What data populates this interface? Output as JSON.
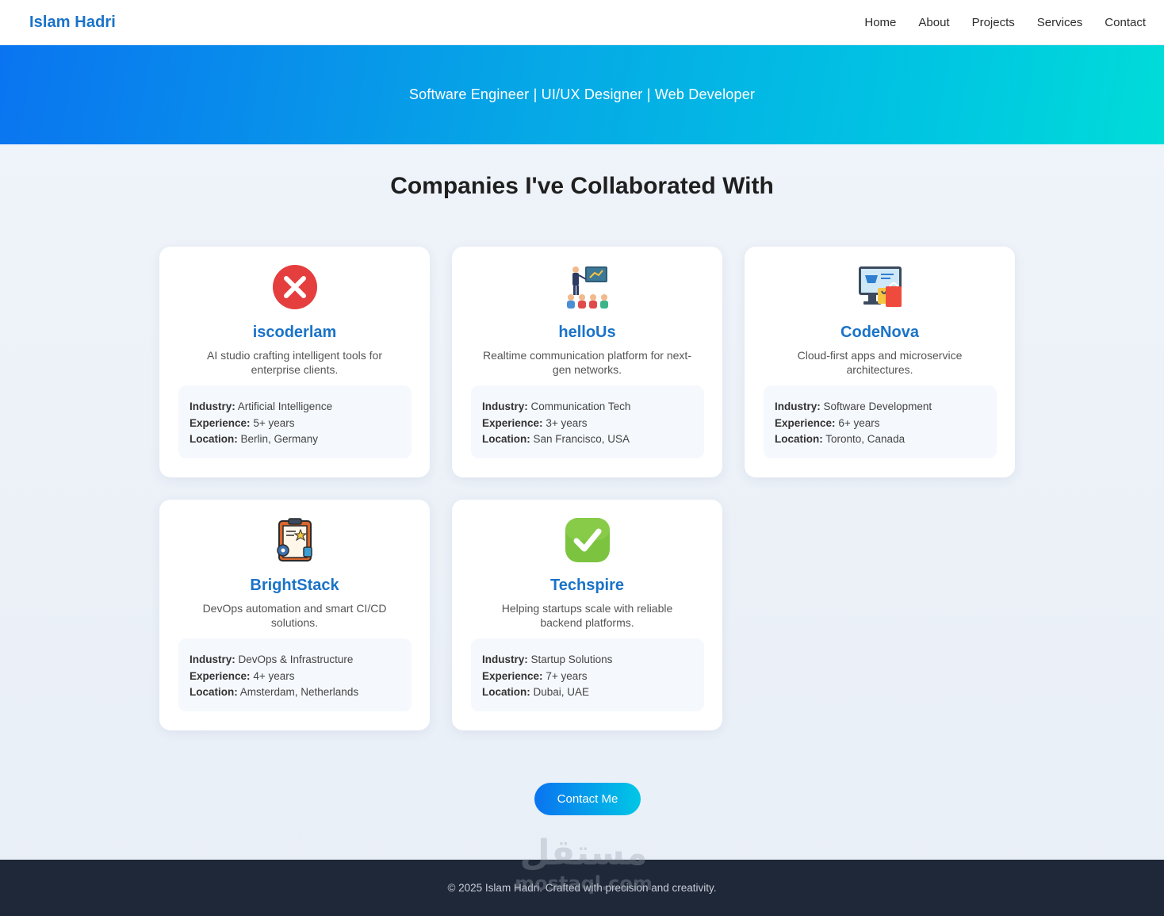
{
  "header": {
    "brand": "Islam Hadri",
    "nav": [
      "Home",
      "About",
      "Projects",
      "Services",
      "Contact"
    ]
  },
  "hero": {
    "tagline": "Software Engineer | UI/UX Designer | Web Developer"
  },
  "section": {
    "title": "Companies I've Collaborated With"
  },
  "labels": {
    "industry": "Industry:",
    "experience": "Experience:",
    "location": "Location:"
  },
  "companies": [
    {
      "name": "iscoderlam",
      "icon": "red-x-circle-icon",
      "description": "AI studio crafting intelligent tools for enterprise clients.",
      "industry": "Artificial Intelligence",
      "experience": "5+ years",
      "location": "Berlin, Germany"
    },
    {
      "name": "helloUs",
      "icon": "presentation-audience-icon",
      "description": "Realtime communication platform for next-gen networks.",
      "industry": "Communication Tech",
      "experience": "3+ years",
      "location": "San Francisco, USA"
    },
    {
      "name": "CodeNova",
      "icon": "online-shopping-monitor-icon",
      "description": "Cloud-first apps and microservice architectures.",
      "industry": "Software Development",
      "experience": "6+ years",
      "location": "Toronto, Canada"
    },
    {
      "name": "BrightStack",
      "icon": "clipboard-gear-icon",
      "description": "DevOps automation and smart CI/CD solutions.",
      "industry": "DevOps & Infrastructure",
      "experience": "4+ years",
      "location": "Amsterdam, Netherlands"
    },
    {
      "name": "Techspire",
      "icon": "green-check-icon",
      "description": "Helping startups scale with reliable backend platforms.",
      "industry": "Startup Solutions",
      "experience": "7+ years",
      "location": "Dubai, UAE"
    }
  ],
  "cta": {
    "label": "Contact Me"
  },
  "footer": {
    "text": "© 2025 Islam Hadri. Crafted with precision and creativity."
  },
  "watermark": {
    "text_ar": "مستقل",
    "text_en": "mostaql.com"
  },
  "colors": {
    "brand": "#1a73c8",
    "hero_start": "#0a74f0",
    "hero_end": "#00dcd8",
    "footer_bg": "#1f2838"
  }
}
